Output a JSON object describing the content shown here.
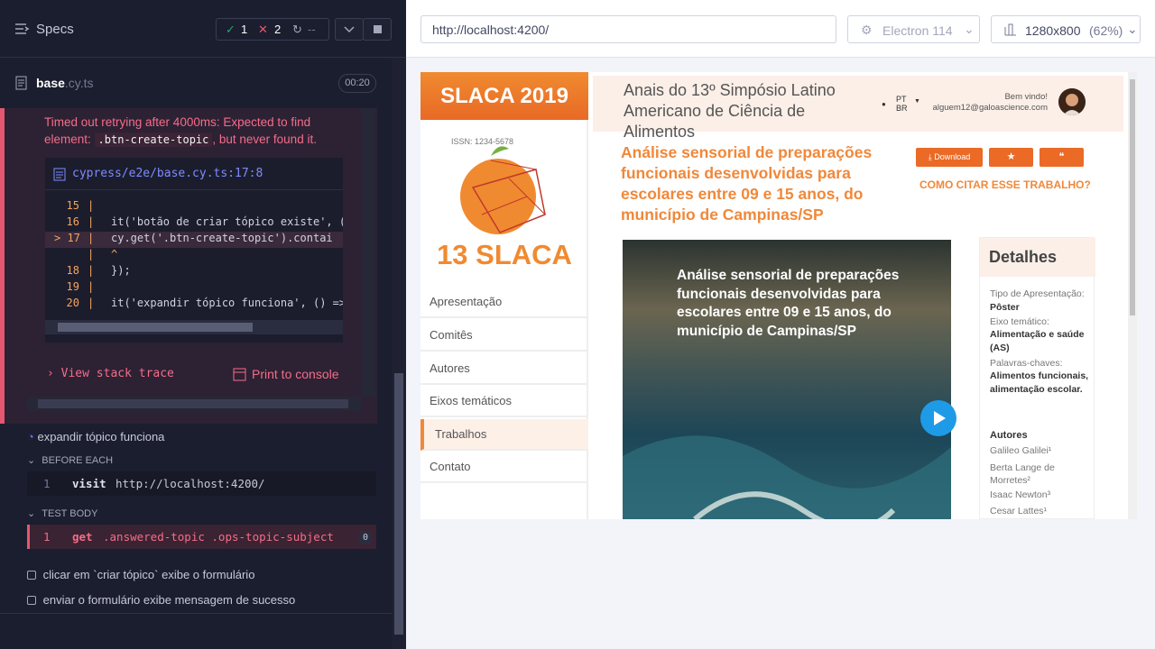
{
  "runner": {
    "specs_label": "Specs",
    "passed": "1",
    "failed": "2",
    "pending": "--",
    "file_name": "base",
    "file_ext": ".cy.ts",
    "duration": "00:20"
  },
  "error": {
    "message_pre": "Timed out retrying after 4000ms: Expected to find element:",
    "selector": ".btn-create-topic",
    "message_post": ", but never found it.",
    "file_link": "cypress/e2e/base.cy.ts:17:8",
    "code_lines": [
      {
        "num": "15",
        "code": ""
      },
      {
        "num": "16",
        "code": "it('botão de criar tópico existe', ("
      },
      {
        "num": "> 17",
        "code": "  cy.get('.btn-create-topic').contai"
      },
      {
        "num": "",
        "code": "      ^"
      },
      {
        "num": "18",
        "code": "});"
      },
      {
        "num": "19",
        "code": ""
      },
      {
        "num": "20",
        "code": "it('expandir tópico funciona', () =>"
      }
    ],
    "view_stack": "View stack trace",
    "print_console": "Print to console"
  },
  "tests": {
    "running_test": "expandir tópico funciona",
    "before_each": "BEFORE EACH",
    "visit_num": "1",
    "visit_cmd": "visit",
    "visit_url": "http://localhost:4200/",
    "test_body": "TEST BODY",
    "get_num": "1",
    "get_cmd": "get",
    "get_sel": ".answered-topic .ops-topic-subject",
    "get_badge": "0",
    "pending1": "clicar em `criar tópico` exibe o formulário",
    "pending2": "enviar o formulário exibe mensagem de sucesso"
  },
  "browser_bar": {
    "url": "http://localhost:4200/",
    "browser": "Electron 114",
    "viewport": "1280x800",
    "scale": "(62%)"
  },
  "site": {
    "brand": "SLACA 2019",
    "logo_text": "13 SLACA",
    "nav": [
      "Apresentação",
      "Comitês",
      "Autores",
      "Eixos temáticos",
      "Trabalhos",
      "Contato"
    ],
    "conference": "Anais do 13º Simpósio Latino Americano de Ciência de Alimentos",
    "issn": "ISSN: 1234-5678",
    "lang": "PT BR",
    "welcome": "Bem vindo!",
    "email": "alguem12@galoascience.com",
    "paper_title": "Análise sensorial de preparações funcionais desenvolvidas para escolares entre 09 e 15 anos, do município de Campinas/SP",
    "download": "Download",
    "cite": "COMO CITAR ESSE TRABALHO?",
    "hero_title": "Análise sensorial de preparações funcionais desenvolvidas para escolares entre 09 e 15 anos, do município de Campinas/SP",
    "details_title": "Detalhes",
    "presentation_label": "Tipo de Apresentação:",
    "presentation_value": "Pôster",
    "axis_label": "Eixo temático:",
    "axis_value": "Alimentação e saúde (AS)",
    "keywords_label": "Palavras-chaves:",
    "keywords_value": "Alimentos funcionais, alimentação escolar.",
    "authors_title": "Autores",
    "authors": [
      "Galileo Galilei¹",
      "Berta Lange de Morretes²",
      "Isaac Newton³",
      "Cesar Lattes¹"
    ]
  },
  "colors": {
    "accent": "#f0883a",
    "error": "#e45770",
    "cypress_bg": "#1b1e2e"
  }
}
